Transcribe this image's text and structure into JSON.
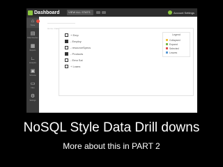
{
  "app": {
    "title": "Dashboard",
    "tab_label": "VIEW ALL STATS",
    "account_name": "Account Settings"
  },
  "sidebar": {
    "items": [
      {
        "icon": "home-icon",
        "glyph": "⌂",
        "label": "Home",
        "active": true
      },
      {
        "icon": "database-icon",
        "glyph": "▤",
        "label": "Data Sources",
        "active": false
      },
      {
        "icon": "bar-chart-icon",
        "glyph": "▦",
        "label": "Reports",
        "active": false
      },
      {
        "icon": "line-chart-icon",
        "glyph": "∟",
        "label": "Analytics",
        "active": false
      },
      {
        "icon": "grid-icon",
        "glyph": "▣",
        "label": "Schema",
        "active": false
      },
      {
        "icon": "folder-icon",
        "glyph": "▭",
        "label": "Files",
        "active": false
      },
      {
        "icon": "gear-icon",
        "glyph": "⚙",
        "label": "Settings",
        "active": false
      }
    ]
  },
  "breadcrumb": {
    "text": "Home / Data"
  },
  "tree": {
    "items": [
      {
        "label": "+ Emp",
        "filled": false
      },
      {
        "label": "- Employ",
        "filled": true
      },
      {
        "label": "- resourceSpecs",
        "filled": false
      },
      {
        "label": "- Products",
        "filled": true
      },
      {
        "label": "- Ema Sal",
        "filled": false
      },
      {
        "label": "+ Loans",
        "filled": false
      }
    ]
  },
  "legend": {
    "title": "Legend",
    "items": [
      {
        "label": "Collapsed",
        "color": "#f0c040"
      },
      {
        "label": "Expand",
        "color": "#7ab648"
      },
      {
        "label": "Selected",
        "color": "#e05050"
      },
      {
        "label": "Leaves",
        "color": "#5b9bd5"
      }
    ]
  },
  "caption": {
    "title": "NoSQL Style Data Drill downs",
    "subtitle": "More about this in PART 2"
  },
  "colors": {
    "background": "#000000",
    "topbar": "#2d2d2d",
    "sidebar": "#3b3b3b",
    "accent": "#8cc63f",
    "badge": "#e74c3c"
  }
}
